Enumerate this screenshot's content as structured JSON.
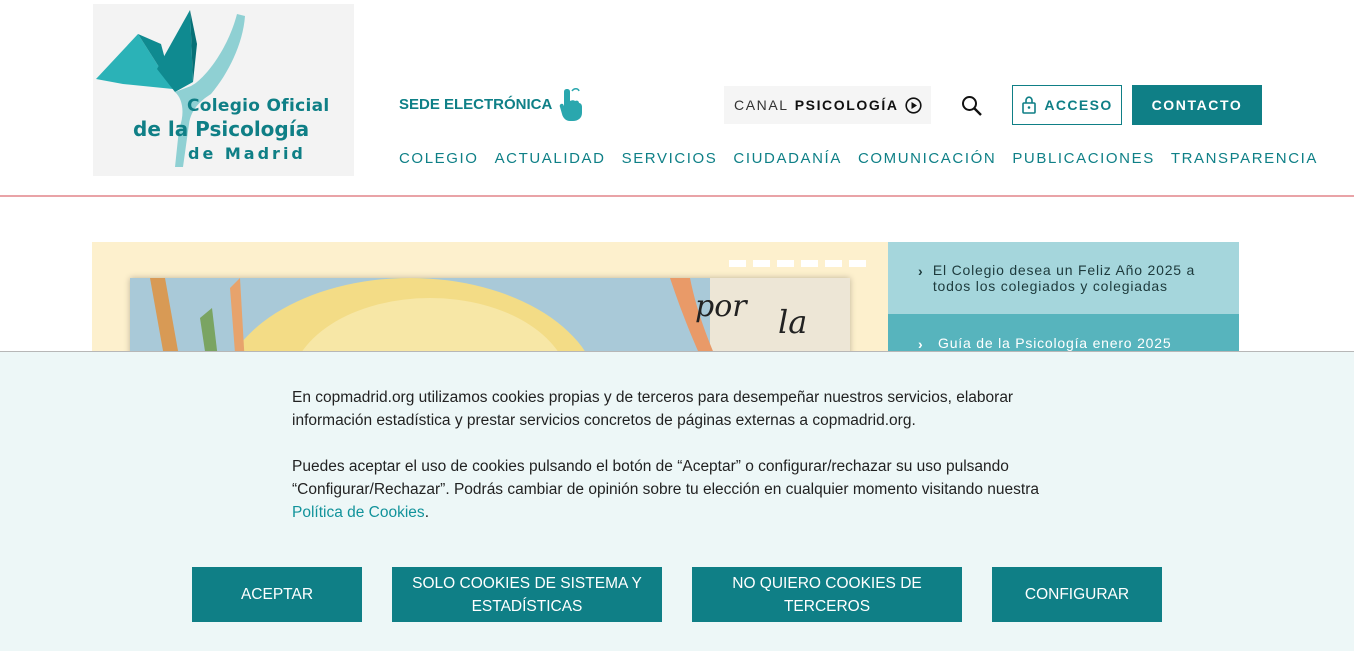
{
  "logo": {
    "line1": "Colegio Oficial",
    "line2": "de la Psicología",
    "line3": "de Madrid"
  },
  "header": {
    "sede_label": "SEDE ELECTRÓNICA",
    "canal_prefix": "CANAL",
    "canal_name": "PSICOLOGÍA",
    "acceso_label": "ACCESO",
    "contacto_label": "CONTACTO"
  },
  "nav": {
    "items": [
      "COLEGIO",
      "ACTUALIDAD",
      "SERVICIOS",
      "CIUDADANÍA",
      "COMUNICACIÓN",
      "PUBLICACIONES",
      "TRANSPARENCIA"
    ]
  },
  "hero": {
    "slides_count": 6,
    "news": [
      "El Colegio desea un Feliz Año 2025 a todos los colegiados y colegiadas",
      "Guía de la Psicología enero 2025"
    ]
  },
  "cookie": {
    "paragraph1": "En copmadrid.org utilizamos cookies propias y de terceros para desempeñar nuestros servicios, elaborar información estadística y prestar servicios concretos de páginas externas a copmadrid.org.",
    "paragraph2": "Puedes aceptar el uso de cookies pulsando el botón de “Aceptar” o configurar/rechazar su uso pulsando “Configurar/Rechazar”. Podrás cambiar de opinión sobre tu elección en cualquier momento visitando nuestra",
    "policy_link": "Política de Cookies",
    "period": ".",
    "buttons": {
      "accept": "ACEPTAR",
      "system_only": "SOLO COOKIES DE SISTEMA Y ESTADÍSTICAS",
      "no_third": "NO QUIERO COOKIES DE TERCEROS",
      "configure": "CONFIGURAR"
    }
  },
  "colors": {
    "brand_teal": "#0f7f86",
    "header_rule": "#e9a3a7",
    "cookie_bg": "#edf7f7"
  }
}
